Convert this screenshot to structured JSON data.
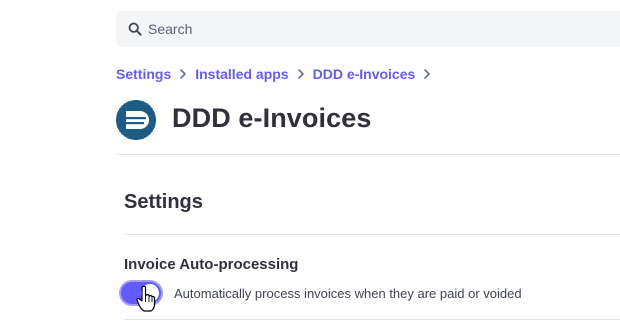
{
  "search": {
    "placeholder": "Search"
  },
  "breadcrumb": {
    "items": [
      {
        "label": "Settings"
      },
      {
        "label": "Installed apps"
      },
      {
        "label": "DDD e-Invoices"
      }
    ]
  },
  "app": {
    "title": "DDD e-Invoices",
    "logo_color": "#1c5c86"
  },
  "settings": {
    "section_title": "Settings",
    "auto_processing": {
      "title": "Invoice Auto-processing",
      "description": "Automatically process invoices when they are paid or voided",
      "enabled": true
    }
  },
  "colors": {
    "accent": "#635bff",
    "text": "#30313d",
    "divider": "#e3e5e8"
  }
}
